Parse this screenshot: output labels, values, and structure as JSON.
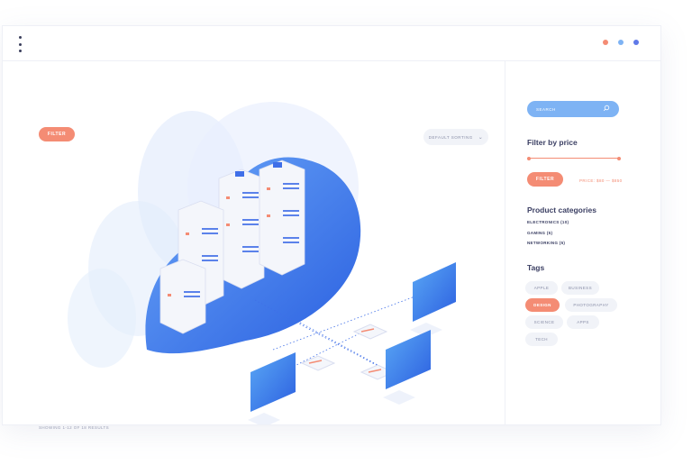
{
  "window": {
    "traffic_dot_colors": [
      "#f48c74",
      "#7eb3f4",
      "#5f79e8"
    ]
  },
  "toolbar": {
    "filter_label": "FILTER",
    "sort_label": "DEFAULT SORTING"
  },
  "main": {
    "results_text": "SHOWING 1-12 OF 18 RESULTS"
  },
  "sidebar": {
    "search_placeholder": "SEARCH",
    "price_heading": "Filter by price",
    "price_filter_label": "FILTER",
    "price_range": "PRICE: $80 — $850",
    "categories_heading": "Product categories",
    "categories": [
      "ELECTRONICS (10)",
      "GAMING (5)",
      "NETWORKING (5)"
    ],
    "tags_heading": "Tags",
    "tags": [
      "APPLE",
      "BUSINESS",
      "DESIGN",
      "PHOTOGRAPHY",
      "SCIENCE",
      "APPS",
      "TECH"
    ],
    "active_tag": "DESIGN"
  },
  "colors": {
    "accent": "#f48c74",
    "primary": "#3f6fe8",
    "search": "#7eb3f4",
    "text": "#3b3f63"
  }
}
